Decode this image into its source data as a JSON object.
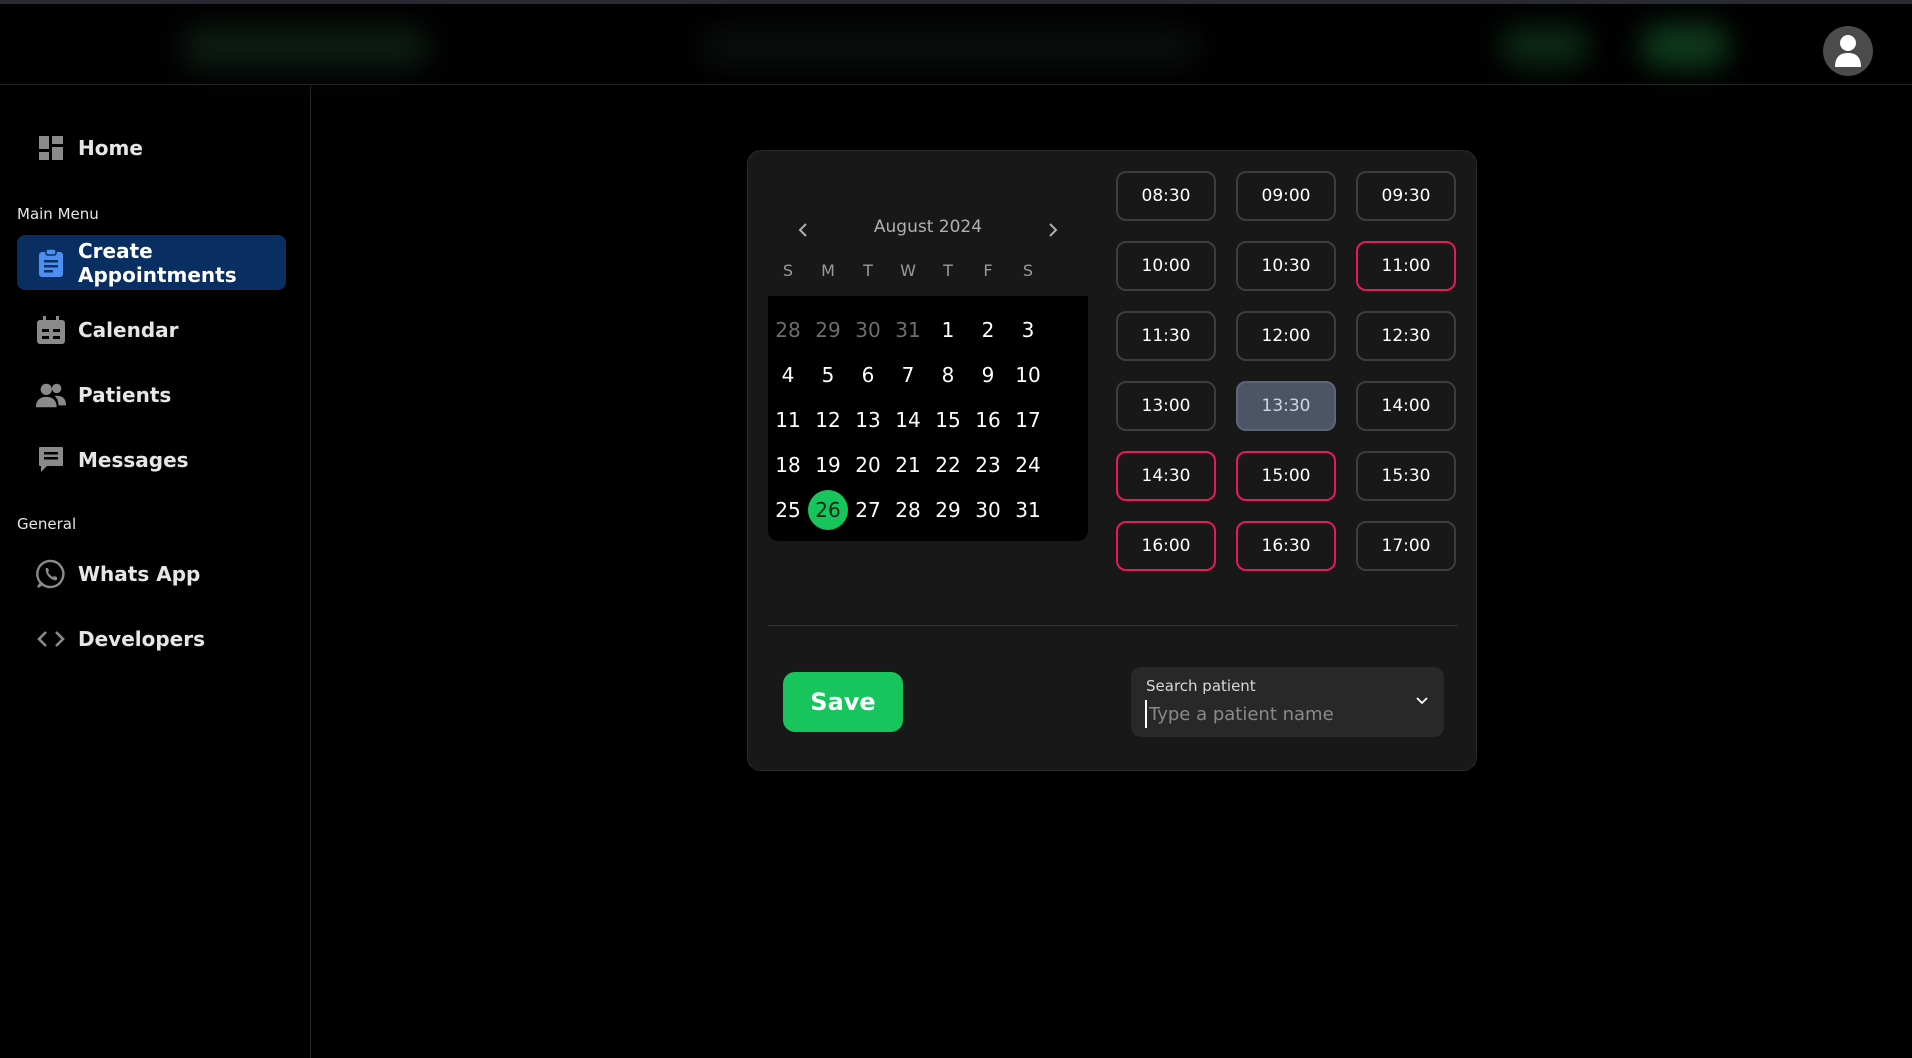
{
  "sidebar": {
    "home": "Home",
    "main_menu_label": "Main Menu",
    "create_appointments": "Create Appointments",
    "calendar": "Calendar",
    "patients": "Patients",
    "messages": "Messages",
    "general_label": "General",
    "whatsapp": "Whats App",
    "developers": "Developers"
  },
  "calendar": {
    "month_label": "August 2024",
    "weekdays": [
      "S",
      "M",
      "T",
      "W",
      "T",
      "F",
      "S"
    ],
    "weeks": [
      [
        "28",
        "29",
        "30",
        "31",
        "1",
        "2",
        "3"
      ],
      [
        "4",
        "5",
        "6",
        "7",
        "8",
        "9",
        "10"
      ],
      [
        "11",
        "12",
        "13",
        "14",
        "15",
        "16",
        "17"
      ],
      [
        "18",
        "19",
        "20",
        "21",
        "22",
        "23",
        "24"
      ],
      [
        "25",
        "26",
        "27",
        "28",
        "29",
        "30",
        "31"
      ]
    ],
    "outside_month_days": [
      "28",
      "29",
      "30",
      "31"
    ],
    "selected_day": "26"
  },
  "time_slots": [
    {
      "time": "08:30",
      "state": "available"
    },
    {
      "time": "09:00",
      "state": "available"
    },
    {
      "time": "09:30",
      "state": "available"
    },
    {
      "time": "10:00",
      "state": "available"
    },
    {
      "time": "10:30",
      "state": "available"
    },
    {
      "time": "11:00",
      "state": "booked"
    },
    {
      "time": "11:30",
      "state": "available"
    },
    {
      "time": "12:00",
      "state": "available"
    },
    {
      "time": "12:30",
      "state": "available"
    },
    {
      "time": "13:00",
      "state": "available"
    },
    {
      "time": "13:30",
      "state": "selected"
    },
    {
      "time": "14:00",
      "state": "available"
    },
    {
      "time": "14:30",
      "state": "booked"
    },
    {
      "time": "15:00",
      "state": "booked"
    },
    {
      "time": "15:30",
      "state": "available"
    },
    {
      "time": "16:00",
      "state": "booked"
    },
    {
      "time": "16:30",
      "state": "booked"
    },
    {
      "time": "17:00",
      "state": "available"
    }
  ],
  "form": {
    "save_label": "Save",
    "search_label": "Search patient",
    "search_placeholder": "Type a patient name",
    "search_value": ""
  },
  "icons": {
    "home": "dashboard-icon",
    "create_appointments": "clipboard-icon",
    "calendar": "calendar-icon",
    "patients": "people-icon",
    "messages": "message-icon",
    "whatsapp": "whatsapp-icon",
    "developers": "code-icon",
    "avatar": "user-icon"
  },
  "colors": {
    "accent_green": "#17c55c",
    "active_nav_bg": "#082e62",
    "active_nav_icon": "#4d8ff0",
    "booked_border": "#e8185a",
    "selected_slot_bg": "#4b5566"
  }
}
